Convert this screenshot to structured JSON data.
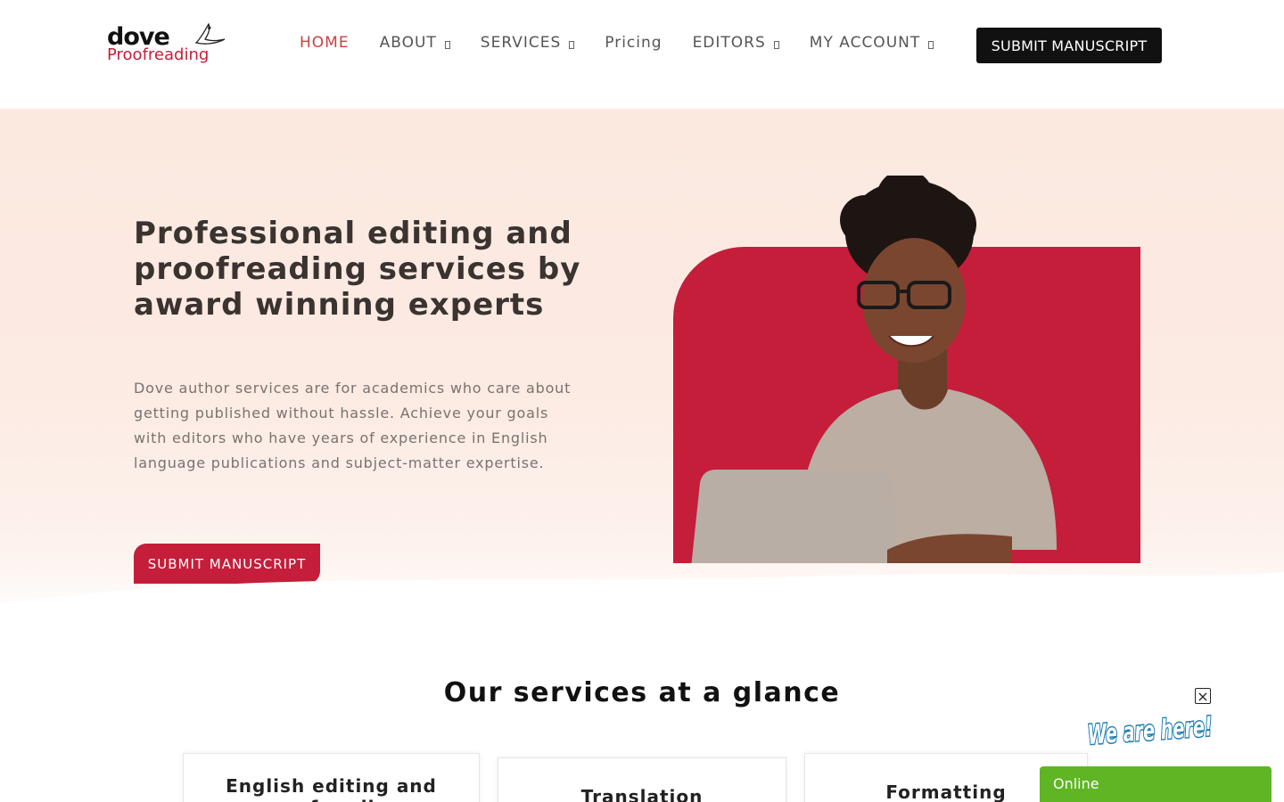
{
  "brand": {
    "logo_top": "dove",
    "logo_bottom": "Proofreading",
    "accent_color": "#c41e3a",
    "dark_color": "#111111"
  },
  "nav": {
    "items": [
      {
        "label": "HOME",
        "active": true,
        "dropdown": false
      },
      {
        "label": "ABOUT",
        "active": false,
        "dropdown": true
      },
      {
        "label": "SERVICES",
        "active": false,
        "dropdown": true
      },
      {
        "label": "Pricing",
        "active": false,
        "dropdown": false
      },
      {
        "label": "EDITORS",
        "active": false,
        "dropdown": true
      },
      {
        "label": "MY ACCOUNT",
        "active": false,
        "dropdown": true
      }
    ],
    "cta_label": "SUBMIT MANUSCRIPT"
  },
  "hero": {
    "title": "Professional editing and proofreading services by award winning experts",
    "description": "Dove author services are for academics who care about getting published without hassle. Achieve your goals with editors who have years of experience in English language publications and subject-matter expertise.",
    "button_label": "SUBMIT MANUSCRIPT"
  },
  "services": {
    "title": "Our services at a glance",
    "cards": [
      {
        "label": "English editing and proofreading"
      },
      {
        "label": "Translation"
      },
      {
        "label": "Formatting"
      }
    ]
  },
  "chat": {
    "badge_text": "We are here!",
    "status": "Online",
    "status_color": "#5fb523"
  }
}
